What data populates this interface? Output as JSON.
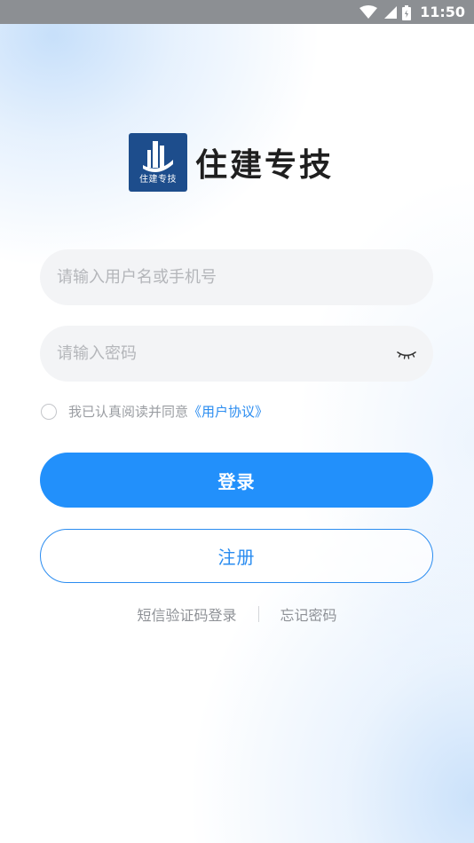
{
  "status_bar": {
    "time": "11:50",
    "icons": [
      "wifi-icon",
      "signal-icon",
      "battery-icon"
    ]
  },
  "brand": {
    "logo_text": "住建专技",
    "title": "住建专技",
    "logo_color": "#1d4d8c"
  },
  "form": {
    "username_placeholder": "请输入用户名或手机号",
    "username_value": "",
    "password_placeholder": "请输入密码",
    "password_value": "",
    "password_toggle_icon": "eye-closed-icon"
  },
  "agreement": {
    "checked": false,
    "text": "我已认真阅读并同意",
    "link_text": "《用户协议》"
  },
  "actions": {
    "login_label": "登录",
    "register_label": "注册"
  },
  "links": {
    "sms_login": "短信验证码登录",
    "forgot_password": "忘记密码"
  },
  "colors": {
    "primary": "#2290fb",
    "link": "#2a8cf0",
    "input_bg": "#f2f3f5",
    "placeholder": "#b4b6ba"
  }
}
